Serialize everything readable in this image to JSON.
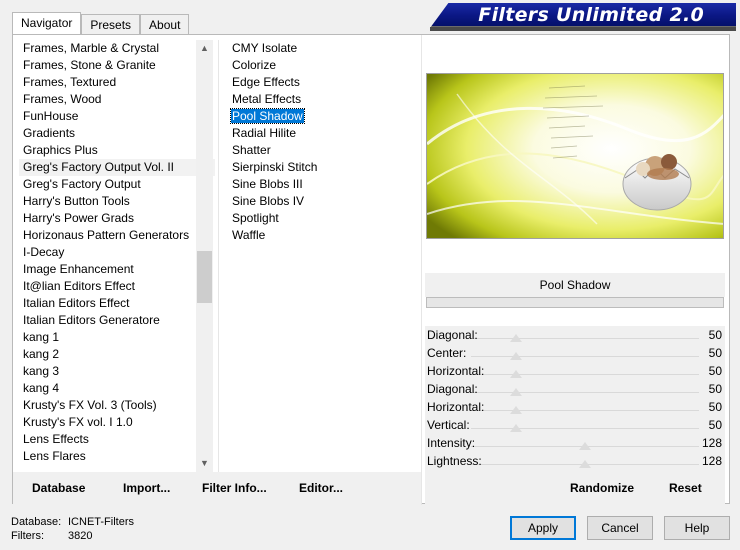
{
  "tabs": [
    "Navigator",
    "Presets",
    "About"
  ],
  "banner_title": "Filters Unlimited 2.0",
  "categories": [
    "Frames, Marble & Crystal",
    "Frames, Stone & Granite",
    "Frames, Textured",
    "Frames, Wood",
    "FunHouse",
    "Gradients",
    "Graphics Plus",
    "Greg's Factory Output Vol. II",
    "Greg's Factory Output",
    "Harry's Button Tools",
    "Harry's Power Grads",
    "Horizonaus Pattern Generators",
    "I-Decay",
    "Image Enhancement",
    "It@lian Editors Effect",
    "Italian Editors Effect",
    "Italian Editors Generatore",
    "kang 1",
    "kang 2",
    "kang 3",
    "kang 4",
    "Krusty's FX Vol. 3 (Tools)",
    "Krusty's FX vol. I 1.0",
    "Lens Effects",
    "Lens Flares"
  ],
  "selected_category_index": 7,
  "filters": [
    "CMY Isolate",
    "Colorize",
    "Edge Effects",
    "Metal Effects",
    "Pool Shadow",
    "Radial Hilite",
    "Shatter",
    "Sierpinski Stitch",
    "Sine Blobs III",
    "Sine Blobs IV",
    "Spotlight",
    "Waffle"
  ],
  "selected_filter_index": 4,
  "filter_name": "Pool Shadow",
  "params": [
    {
      "label": "Diagonal:",
      "value": "50"
    },
    {
      "label": "Center:",
      "value": "50"
    },
    {
      "label": "Horizontal:",
      "value": "50"
    },
    {
      "label": "Diagonal:",
      "value": "50"
    },
    {
      "label": "Horizontal:",
      "value": "50"
    },
    {
      "label": "Vertical:",
      "value": "50"
    },
    {
      "label": "Intensity:",
      "value": "128"
    },
    {
      "label": "Lightness:",
      "value": "128"
    }
  ],
  "left_buttons": {
    "database": "Database",
    "import": "Import...",
    "filter_info": "Filter Info...",
    "editor": "Editor..."
  },
  "right_buttons": {
    "randomize": "Randomize",
    "reset": "Reset"
  },
  "status": {
    "database_label": "Database:",
    "database_value": "ICNET-Filters",
    "filters_label": "Filters:",
    "filters_value": "3820"
  },
  "dialog_buttons": {
    "apply": "Apply",
    "cancel": "Cancel",
    "help": "Help"
  },
  "colors": {
    "banner": "#0b1784",
    "selection": "#0078d7"
  }
}
